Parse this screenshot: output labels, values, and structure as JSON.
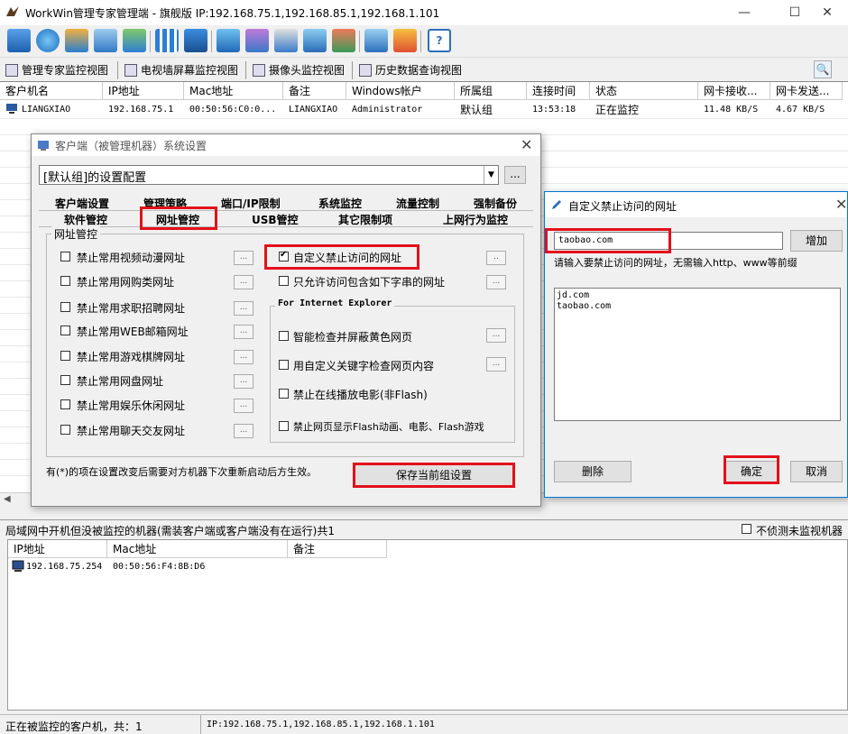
{
  "app": {
    "title": "WorkWin管理专家管理端 - 旗舰版 IP:192.168.75.1,192.168.85.1,192.168.1.101"
  },
  "window_controls": {
    "minimize": "—",
    "maximize": "☐",
    "close": "✕"
  },
  "toolbar": {
    "icons": [
      "monitor-group-icon",
      "globe-icon",
      "network-settings-icon",
      "user-search-icon",
      "users-config-icon",
      "grid-icon",
      "lock-user-icon",
      "remote-screen-icon",
      "broadcast-icon",
      "search-doc-icon",
      "windows-icon",
      "chart-icon",
      "ip-settings-icon",
      "alarm-icon",
      "help-icon"
    ]
  },
  "view_tabs": [
    {
      "label": "管理专家监控视图"
    },
    {
      "label": "电视墙屏幕监控视图"
    },
    {
      "label": "摄像头监控视图"
    },
    {
      "label": "历史数据查询视图"
    }
  ],
  "grid": {
    "columns": [
      "客户机名",
      "IP地址",
      "Mac地址",
      "备注",
      "Windows帐户",
      "所属组",
      "连接时间",
      "状态",
      "网卡接收...",
      "网卡发送..."
    ],
    "rows": [
      {
        "name": "LIANGXIAO",
        "ip": "192.168.75.1",
        "mac": "00:50:56:C0:0...",
        "note": "LIANGXIAO",
        "account": "Administrator",
        "group": "默认组",
        "time": "13:53:18",
        "status": "正在监控",
        "rx": "11.48 KB/S",
        "tx": "4.67 KB/S"
      }
    ]
  },
  "lan_panel": {
    "title": "局域网中开机但没被监控的机器(需装客户端或客户端没有在运行)共1",
    "ignore_label": "不侦测未监视机器",
    "columns": [
      "IP地址",
      "Mac地址",
      "备注"
    ],
    "rows": [
      {
        "ip": "192.168.75.254",
        "mac": "00:50:56:F4:8B:D6",
        "note": ""
      }
    ]
  },
  "status_bar": {
    "left": "正在被监控的客户机，共：1",
    "right": "IP:192.168.75.1,192.168.85.1,192.168.1.101"
  },
  "settings_dialog": {
    "title": "客户端（被管理机器）系统设置",
    "config_combo": "[默认组]的设置配置",
    "more_button": "...",
    "tabs_row1": [
      "客户端设置",
      "管理策略",
      "端口/IP限制",
      "系统监控",
      "流量控制",
      "强制备份"
    ],
    "tabs_row2": [
      "软件管控",
      "网址管控",
      "USB管控",
      "其它限制项",
      "上网行为监控"
    ],
    "active_tab": "网址管控",
    "group_label": "网址管控",
    "left_options": [
      "禁止常用视频动漫网址",
      "禁止常用网购类网址",
      "禁止常用求职招聘网址",
      "禁止常用WEB邮箱网址",
      "禁止常用游戏棋牌网址",
      "禁止常用网盘网址",
      "禁止常用娱乐休闲网址",
      "禁止常用聊天交友网址"
    ],
    "custom_block": "自定义禁止访问的网址",
    "only_allow": "只允许访问包含如下字串的网址",
    "ie_group": "For Internet Explorer",
    "ie_options": [
      "智能检查并屏蔽黄色网页",
      "用自定义关键字检查网页内容",
      "禁止在线播放电影(非Flash)",
      "禁止网页显示Flash动画、电影、Flash游戏"
    ],
    "note": "有(*)的项在设置改变后需要对方机器下次重新启动后方生效。",
    "save_button": "保存当前组设置",
    "dot_button": "..",
    "dots": "..."
  },
  "url_dialog": {
    "title": "自定义禁止访问的网址",
    "input_value": "taobao.com",
    "add_button": "增加",
    "hint": "请输入要禁止访问的网址，无需输入http、www等前缀",
    "list": [
      "jd.com",
      "taobao.com"
    ],
    "delete_button": "删除",
    "ok_button": "确定",
    "cancel_button": "取消"
  },
  "colors": {
    "highlight_box": "#e3101b",
    "accent": "#0078d7"
  }
}
